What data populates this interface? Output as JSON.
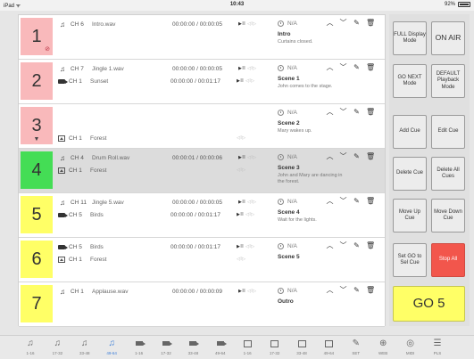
{
  "status": {
    "left": "iPad ᯤ",
    "time": "10:43",
    "battery": "92%"
  },
  "colors": {
    "pink": "#f9b9bb",
    "green": "#44dd55",
    "yellow": "#ffff66",
    "red": "#f2564c",
    "accent": "#3d7fd9"
  },
  "cues": [
    {
      "number": "1",
      "color": "#f9b9bb",
      "badge": "⊘",
      "down": "",
      "tracks": [
        {
          "icon": "music",
          "ch": "CH 6",
          "file": "Intro.wav",
          "time": "00:00:00 / 00:00:05"
        }
      ],
      "na": "N/A",
      "scene": "Intro",
      "note": "Curtains closed."
    },
    {
      "number": "2",
      "color": "#f9b9bb",
      "badge": "",
      "down": "",
      "tracks": [
        {
          "icon": "music",
          "ch": "CH 7",
          "file": "Jingle 1.wav",
          "time": "00:00:00 / 00:00:05"
        },
        {
          "icon": "video",
          "ch": "CH 1",
          "file": "Sunset",
          "time": "00:00:00 / 00:01:17"
        }
      ],
      "na": "N/A",
      "scene": "Scene 1",
      "note": "John comes to the stage."
    },
    {
      "number": "3",
      "color": "#f9b9bb",
      "badge": "",
      "down": "▼",
      "tracks": [
        {
          "icon": "image",
          "ch": "CH 1",
          "file": "Forest",
          "time": ""
        }
      ],
      "na": "N/A",
      "scene": "Scene 2",
      "note": "Mary wakes up."
    },
    {
      "number": "4",
      "color": "#44dd55",
      "badge": "",
      "down": "",
      "tracks": [
        {
          "icon": "music",
          "ch": "CH 4",
          "file": "Drum Roll.wav",
          "time": "00:00:01 / 00:00:06"
        },
        {
          "icon": "image",
          "ch": "CH 1",
          "file": "Forest",
          "time": ""
        }
      ],
      "na": "N/A",
      "scene": "Scene 3",
      "note": "John and Mary are dancing in the forest."
    },
    {
      "number": "5",
      "color": "#ffff66",
      "badge": "",
      "down": "",
      "tracks": [
        {
          "icon": "music",
          "ch": "CH 11",
          "file": "Jingle 5.wav",
          "time": "00:00:00 / 00:00:05"
        },
        {
          "icon": "video",
          "ch": "CH 5",
          "file": "Birds",
          "time": "00:00:00 / 00:01:17"
        }
      ],
      "na": "N/A",
      "scene": "Scene 4",
      "note": "Wait for the lights."
    },
    {
      "number": "6",
      "color": "#ffff66",
      "badge": "",
      "down": "",
      "tracks": [
        {
          "icon": "video",
          "ch": "CH 5",
          "file": "Birds",
          "time": "00:00:00 / 00:01:17"
        },
        {
          "icon": "image",
          "ch": "CH 1",
          "file": "Forest",
          "time": ""
        }
      ],
      "na": "N/A",
      "scene": "Scene 5",
      "note": ""
    },
    {
      "number": "7",
      "color": "#ffff66",
      "badge": "",
      "down": "",
      "tracks": [
        {
          "icon": "music",
          "ch": "CH 1",
          "file": "Applause.wav",
          "time": "00:00:00 / 00:00:09"
        }
      ],
      "na": "N/A",
      "scene": "Outro",
      "note": ""
    }
  ],
  "transport": {
    "play": "▶II",
    "stop": "■",
    "fade": "◁I▷"
  },
  "actions": {
    "up": "︿",
    "down": "﹀",
    "edit": "✎",
    "delete": "🗑"
  },
  "panel": {
    "full_display": "FULL Display Mode",
    "on_air": "ON AIR",
    "go_next": "GO NEXT Mode",
    "default_playback": "DEFAULT Playback Mode",
    "add_cue": "Add Cue",
    "edit_cue": "Edit Cue",
    "delete_cue": "Delete Cue",
    "delete_all": "Delete All Cues",
    "move_up": "Move Up Cue",
    "move_down": "Move Down Cue",
    "set_go": "Set GO to Sel Cue",
    "stop_all": "Stop All",
    "go": "GO 5"
  },
  "bottom_tabs": [
    {
      "icon": "music",
      "label": "1-16"
    },
    {
      "icon": "music",
      "label": "17-32"
    },
    {
      "icon": "music",
      "label": "33-48"
    },
    {
      "icon": "music",
      "label": "49-64",
      "selected": true
    },
    {
      "icon": "video",
      "label": "1-16"
    },
    {
      "icon": "video",
      "label": "17-32"
    },
    {
      "icon": "video",
      "label": "33-48"
    },
    {
      "icon": "video",
      "label": "49-64"
    },
    {
      "icon": "image",
      "label": "1-16"
    },
    {
      "icon": "image",
      "label": "17-32"
    },
    {
      "icon": "image",
      "label": "33-48"
    },
    {
      "icon": "image",
      "label": "49-64"
    },
    {
      "icon": "set",
      "label": "SET"
    },
    {
      "icon": "web",
      "label": "WEB"
    },
    {
      "icon": "midi",
      "label": "MIDI"
    },
    {
      "icon": "pls",
      "label": "PLS"
    }
  ]
}
